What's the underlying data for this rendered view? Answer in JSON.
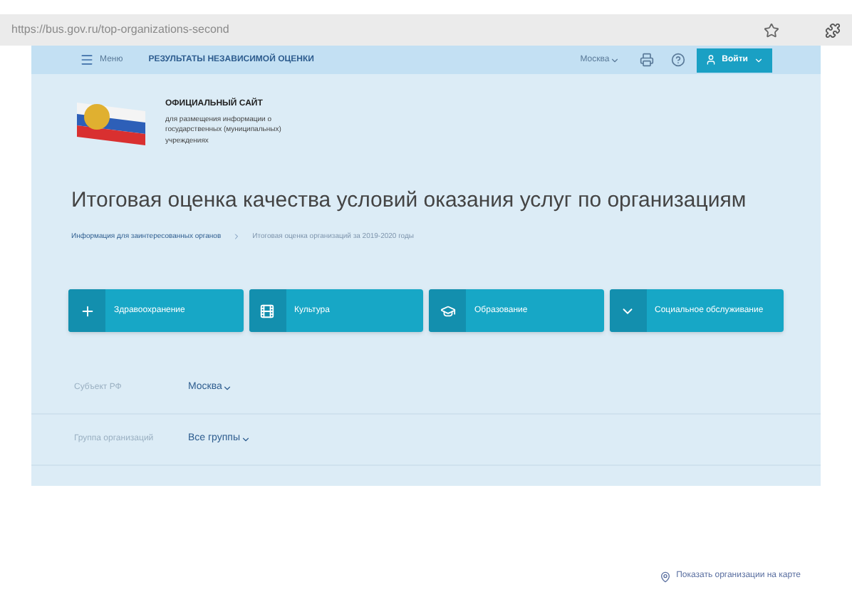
{
  "browser": {
    "url": "https://bus.gov.ru/top-organizations-second"
  },
  "nav": {
    "menu": "Меню",
    "section": "РЕЗУЛЬТАТЫ НЕЗАВИСИМОЙ ОЦЕНКИ",
    "region": "Москва",
    "login": "Войти"
  },
  "header": {
    "title": "ОФИЦИАЛЬНЫЙ САЙТ",
    "subtitle": "для размещения информации о государственных (муниципальных) учреждениях"
  },
  "page_title": "Итоговая оценка качества условий оказания услуг по организациям",
  "breadcrumbs": [
    "Информация для заинтересованных органов",
    "Итоговая оценка организаций за 2019-2020 годы"
  ],
  "categories": [
    {
      "label": "Здравоохранение",
      "kind": "health"
    },
    {
      "label": "Культура",
      "kind": "culture"
    },
    {
      "label": "Образование",
      "kind": "education"
    },
    {
      "label": "Социальное обслуживание",
      "kind": "social"
    }
  ],
  "filters": [
    {
      "label": "Субъект РФ",
      "value": "Москва"
    },
    {
      "label": "Группа организаций",
      "value": "Все группы"
    }
  ],
  "map_link": "Показать организации на карте"
}
